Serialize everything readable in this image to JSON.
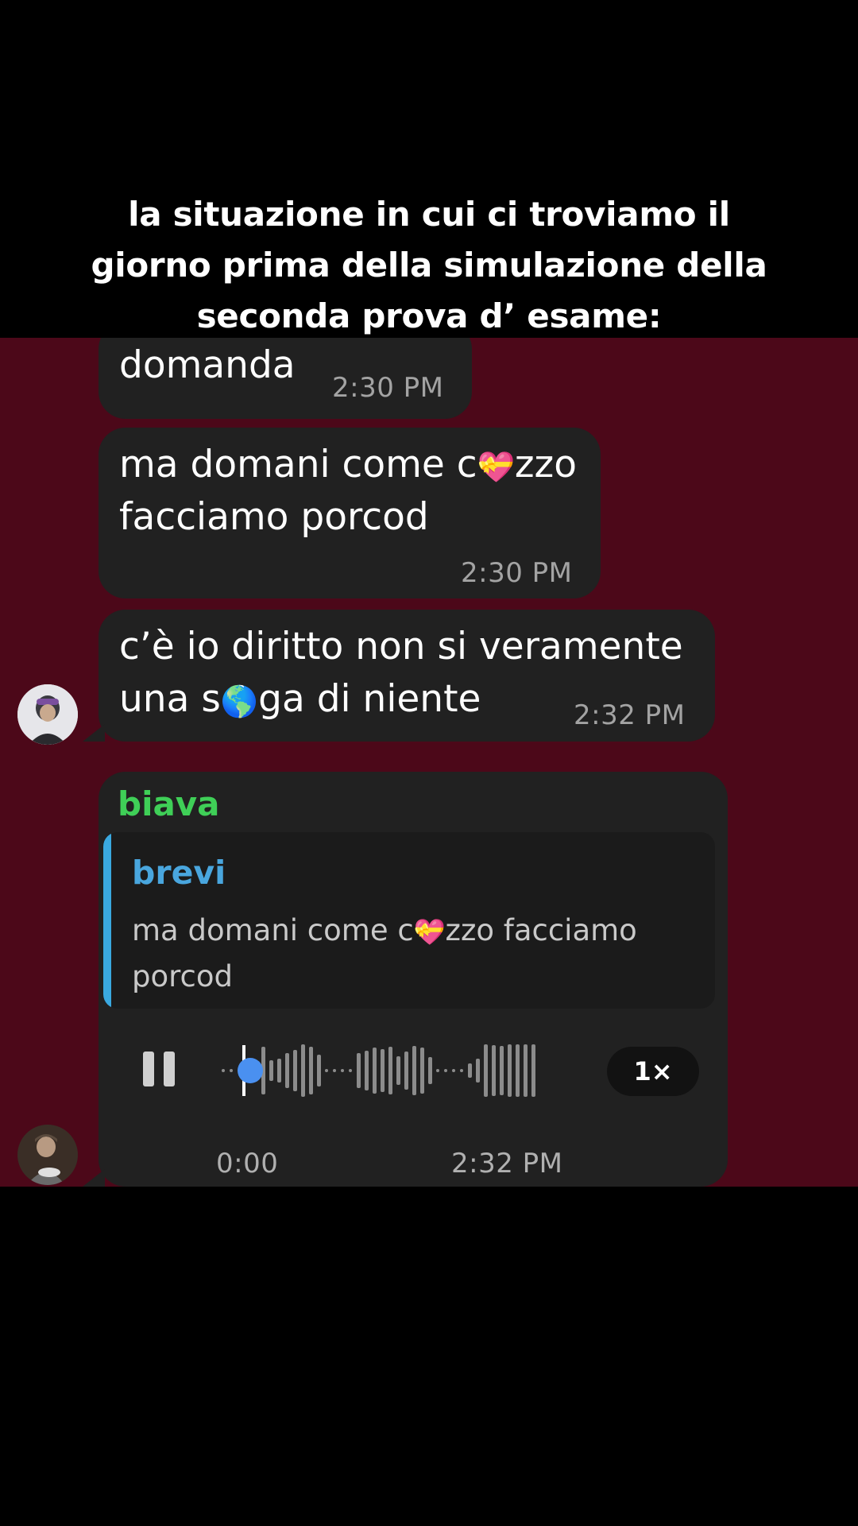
{
  "caption": {
    "lines": [
      "la situazione in cui ci troviamo il",
      "giorno prima della simulazione della",
      "seconda prova d’ esame:"
    ]
  },
  "messages": [
    {
      "text": "domanda",
      "time": "2:30 PM"
    },
    {
      "line1_a": "ma domani come c",
      "emoji": "💝",
      "line1_b": "zzo",
      "line2": "facciamo porcod",
      "time": "2:30 PM"
    },
    {
      "line1": "c’è io diritto non si veramente",
      "line2_a": "una s",
      "emoji": "🌎",
      "line2_b": "ga di niente",
      "time": "2:32 PM"
    }
  ],
  "voice_message": {
    "sender": "biava",
    "reply": {
      "name": "brevi",
      "text_a": "ma domani come c",
      "emoji": "💝",
      "text_b": "zzo facciamo",
      "text_line2": "porcod"
    },
    "elapsed": "0:00",
    "time": "2:32 PM",
    "speed": "1×",
    "progress": 0.07
  },
  "colors": {
    "chat_background": "#4c0819",
    "bubble": "#212121",
    "sender_name": "#3fcf57",
    "reply_accent": "#3aa9e0",
    "play_head": "#4a90f0"
  },
  "icons": [
    "pause-icon",
    "mic-icon"
  ]
}
